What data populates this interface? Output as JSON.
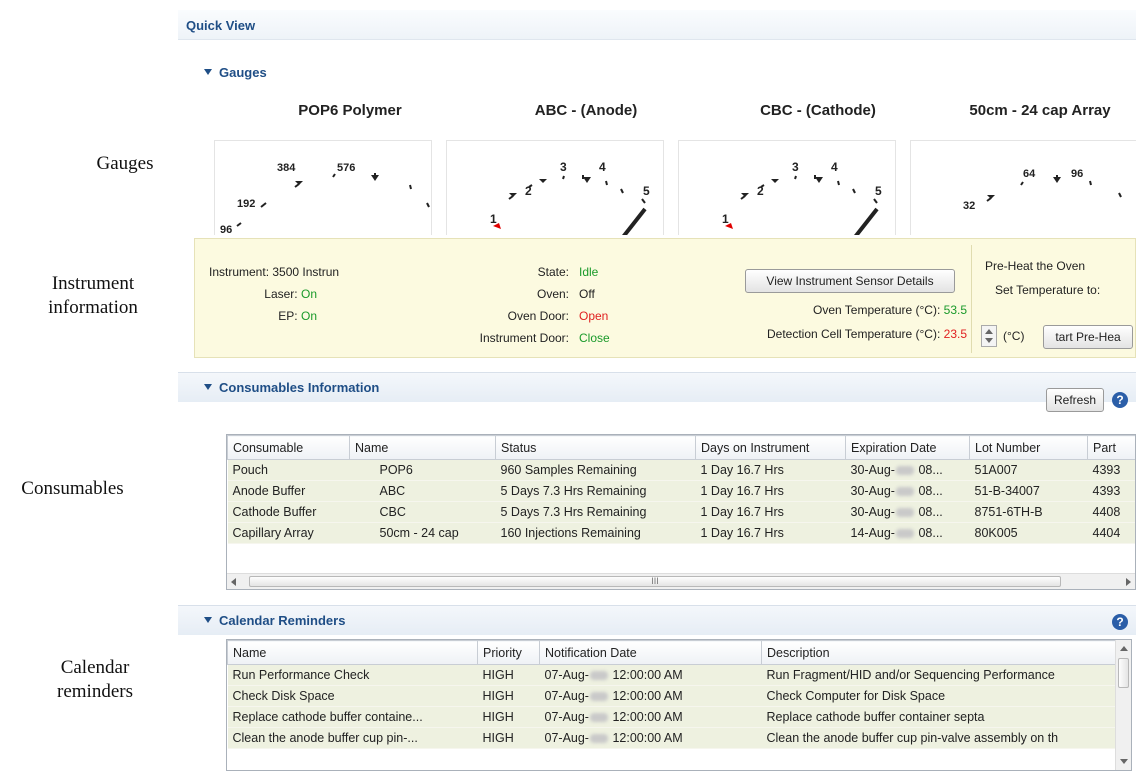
{
  "annotations": {
    "gauges": "Gauges",
    "instrument_line1": "Instrument",
    "instrument_line2": "information",
    "consumables": "Consumables",
    "calendar_line1": "Calendar",
    "calendar_line2": "reminders"
  },
  "quick_view": {
    "title": "Quick View"
  },
  "gauges_section": {
    "header": "Gauges",
    "gauges": [
      {
        "title": "POP6 Polymer",
        "ticks": [
          "96",
          "192",
          "384",
          "576"
        ]
      },
      {
        "title": "ABC - (Anode)",
        "ticks": [
          "1",
          "2",
          "3",
          "4",
          "5"
        ]
      },
      {
        "title": "CBC - (Cathode)",
        "ticks": [
          "1",
          "2",
          "3",
          "4",
          "5"
        ]
      },
      {
        "title": "50cm - 24 cap Array",
        "ticks": [
          "32",
          "64",
          "96"
        ]
      }
    ]
  },
  "instrument": {
    "instrument_label": "Instrument:",
    "instrument_value": "3500 Instrun",
    "laser_label": "Laser:",
    "laser_value": "On",
    "ep_label": "EP:",
    "ep_value": "On",
    "state_label": "State:",
    "state_value": "Idle",
    "oven_label": "Oven:",
    "oven_value": "Off",
    "oven_door_label": "Oven Door:",
    "oven_door_value": "Open",
    "instrument_door_label": "Instrument Door:",
    "instrument_door_value": "Close",
    "sensor_button": "View Instrument Sensor Details",
    "oven_temp_label": "Oven Temperature (°C):",
    "oven_temp_value": "53.5",
    "cell_temp_label": "Detection Cell Temperature (°C):",
    "cell_temp_value": "23.5",
    "preheat_title": "Pre-Heat the Oven",
    "set_temp_label": "Set Temperature to:",
    "temp_unit": "(°C)",
    "start_button": "tart Pre-Hea",
    "colors": {
      "on": "#1a9a2a",
      "alert": "#e02020"
    }
  },
  "consumables_section": {
    "header": "Consumables Information",
    "refresh_button": "Refresh",
    "columns": [
      "Consumable",
      "Name",
      "Status",
      "Days on Instrument",
      "Expiration Date",
      "Lot Number",
      "Part"
    ],
    "rows": [
      {
        "consumable": "Pouch",
        "name": "POP6",
        "status": "960 Samples Remaining",
        "days": "1 Day 16.7 Hrs",
        "exp_pre": "30-Aug-",
        "exp_post": " 08...",
        "lot": "51A007",
        "part": "4393"
      },
      {
        "consumable": "Anode Buffer",
        "name": "ABC",
        "status": "5 Days 7.3 Hrs Remaining",
        "days": "1 Day 16.7 Hrs",
        "exp_pre": "30-Aug-",
        "exp_post": " 08...",
        "lot": "51-B-34007",
        "part": "4393"
      },
      {
        "consumable": "Cathode Buffer",
        "name": "CBC",
        "status": "5 Days 7.3 Hrs Remaining",
        "days": "1 Day 16.7 Hrs",
        "exp_pre": "30-Aug-",
        "exp_post": " 08...",
        "lot": "8751-6TH-B",
        "part": "4408"
      },
      {
        "consumable": "Capillary Array",
        "name": "50cm - 24 cap",
        "status": "160 Injections Remaining",
        "days": "1 Day 16.7 Hrs",
        "exp_pre": "14-Aug-",
        "exp_post": " 08...",
        "lot": "80K005",
        "part": "4404"
      }
    ],
    "scroll_grip": "III"
  },
  "calendar_section": {
    "header": "Calendar Reminders",
    "columns": [
      "Name",
      "Priority",
      "Notification Date",
      "Description"
    ],
    "rows": [
      {
        "name": "Run  Performance Check",
        "priority": "HIGH",
        "date_pre": "07-Aug-",
        "date_post": " 12:00:00 AM",
        "description": "Run Fragment/HID and/or Sequencing Performance"
      },
      {
        "name": "Check Disk Space",
        "priority": "HIGH",
        "date_pre": "07-Aug-",
        "date_post": " 12:00:00 AM",
        "description": "Check Computer for Disk Space"
      },
      {
        "name": "Replace cathode buffer containe...",
        "priority": "HIGH",
        "date_pre": "07-Aug-",
        "date_post": " 12:00:00 AM",
        "description": "Replace cathode buffer container septa"
      },
      {
        "name": "Clean the anode buffer cup pin-...",
        "priority": "HIGH",
        "date_pre": "07-Aug-",
        "date_post": " 12:00:00 AM",
        "description": "Clean the anode buffer cup pin-valve assembly on th"
      }
    ]
  },
  "help_glyph": "?"
}
